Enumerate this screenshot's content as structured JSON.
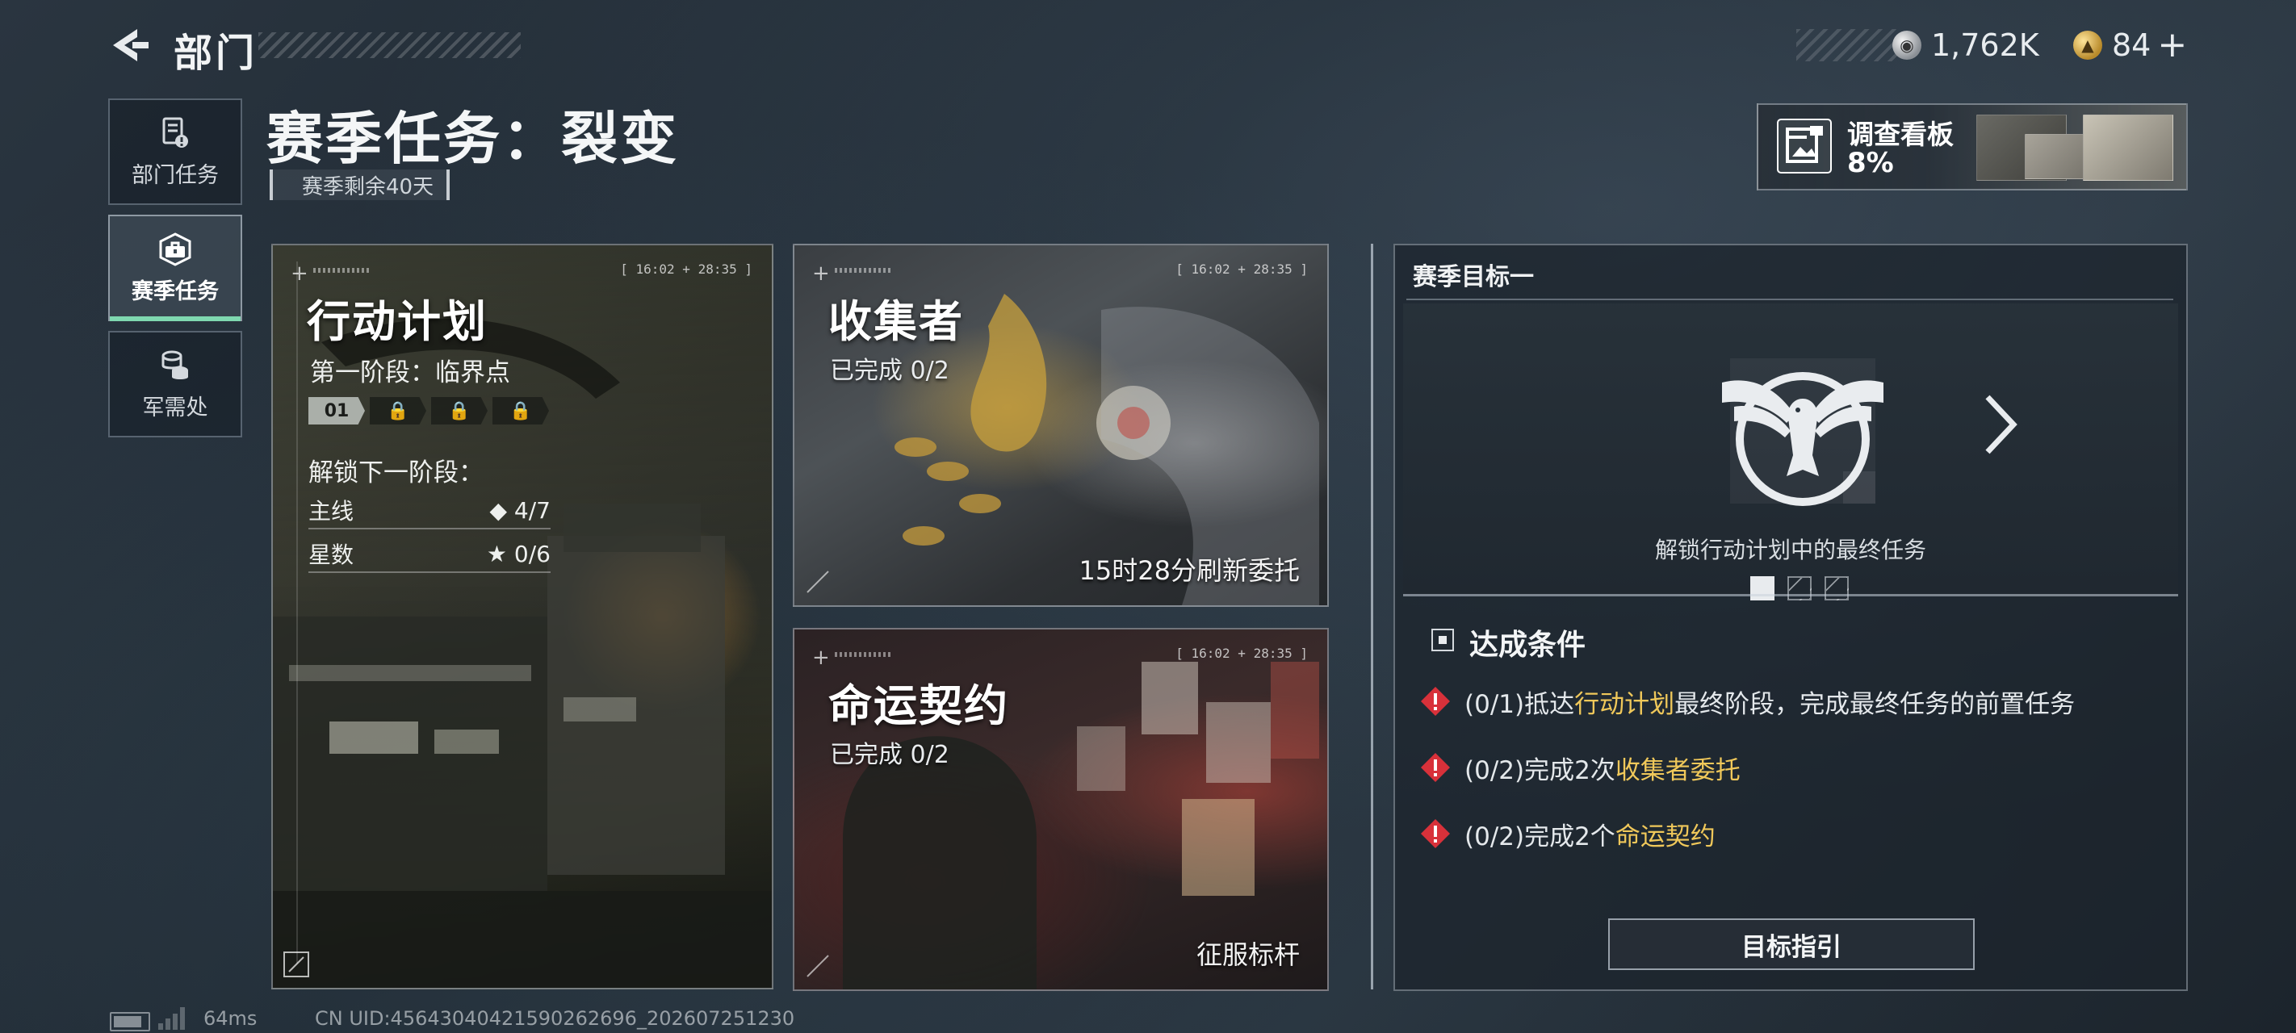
{
  "header": {
    "title": "部门"
  },
  "currency": [
    {
      "icon": "silver-coin-icon",
      "value": "1,762K"
    },
    {
      "icon": "gold-token-icon",
      "value": "84",
      "add_label": "+"
    }
  ],
  "sidebar": {
    "items": [
      {
        "icon": "department-task-icon",
        "label": "部门任务",
        "active": false
      },
      {
        "icon": "season-task-icon",
        "label": "赛季任务",
        "active": true
      },
      {
        "icon": "supply-icon",
        "label": "军需处",
        "active": false
      }
    ]
  },
  "page": {
    "title": "赛季任务：裂变",
    "remaining": "赛季剩余40天"
  },
  "survey_board": {
    "title": "调查看板",
    "progress": "8%"
  },
  "cards": {
    "plan": {
      "title": "行动计划",
      "time_tag": "[ 16:02 + 28:35 ]",
      "stage": "第一阶段：临界点",
      "stage_segments": [
        "01",
        "",
        "",
        ""
      ],
      "unlock_label": "解锁下一阶段：",
      "requirements": [
        {
          "label": "主线",
          "value": "◆ 4/7"
        },
        {
          "label": "星数",
          "value": "★ 0/6"
        }
      ]
    },
    "collector": {
      "title": "收集者",
      "time_tag": "[ 16:02 + 28:35 ]",
      "status": "已完成 0/2",
      "footer": "15时28分刷新委托"
    },
    "contract": {
      "title": "命运契约",
      "time_tag": "[ 16:02 + 28:35 ]",
      "status": "已完成 0/2",
      "footer": "征服标杆"
    }
  },
  "goal": {
    "title": "赛季目标一",
    "caption": "解锁行动计划中的最终任务",
    "conditions_title": "达成条件",
    "conditions": [
      {
        "prefix": "(0/1)抵达",
        "highlight": "行动计划",
        "suffix": "最终阶段，完成最终任务的前置任务"
      },
      {
        "prefix": "(0/2)完成2次",
        "highlight": "收集者委托",
        "suffix": ""
      },
      {
        "prefix": "(0/2)完成2个",
        "highlight": "命运契约",
        "suffix": ""
      }
    ],
    "guide_button": "目标指引",
    "highlight_color": "#f0c85a",
    "pager_active_index": 0,
    "pager_count": 3
  },
  "footer": {
    "ping": "64ms",
    "uid": "CN UID:4564304042159026269​6_202607251230"
  }
}
